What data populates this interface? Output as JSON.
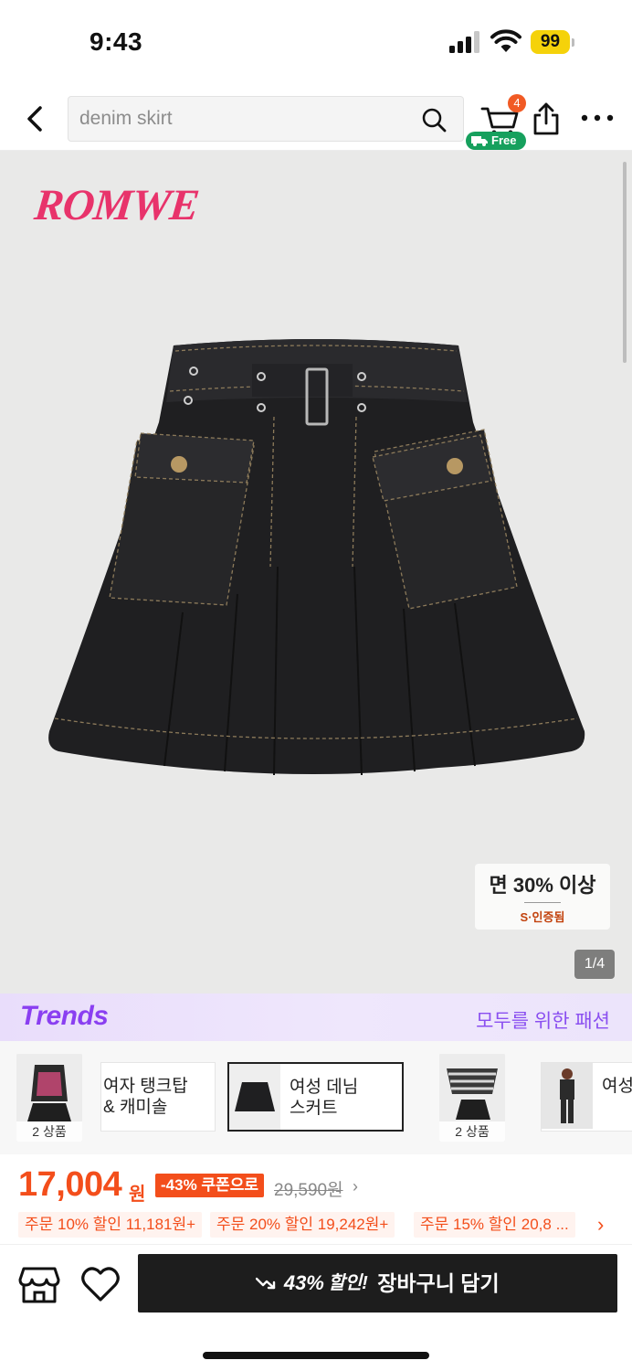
{
  "status_bar": {
    "time": "9:43",
    "battery": "99",
    "battery_color": "#f5d20a"
  },
  "header": {
    "search_placeholder": "denim skirt",
    "cart_count": "4",
    "free_shipping_label": "Free",
    "icons": [
      "back-arrow-icon",
      "search-icon",
      "cart-icon",
      "truck-icon",
      "share-icon",
      "more-icon"
    ]
  },
  "product_image": {
    "brand": "ROMWE",
    "brand_color": "#e8336b",
    "cert_title": "면 30% 이상",
    "cert_sub": "S·인증됨",
    "counter": "1/4"
  },
  "trends": {
    "logo": "Trends",
    "slogan": "모두를 위한 패션",
    "accent": "#8a3ff1",
    "items": [
      {
        "type": "thumb",
        "count": "2 상품"
      },
      {
        "type": "chip",
        "label": "여자 탱크탑\n& 캐미솔",
        "active": false
      },
      {
        "type": "chip",
        "label": "여성 데님\n스커트",
        "active": true
      },
      {
        "type": "thumb",
        "count": "2 상품"
      },
      {
        "type": "chip",
        "label": "여성",
        "active": false
      }
    ]
  },
  "price": {
    "current": "17,004",
    "unit": "원",
    "discount_tag": "-43% 쿠폰으로",
    "original": "29,590원",
    "accent": "#f34e1b",
    "promos": [
      "주문 10% 할인 11,181원+",
      "주문 20% 할인 19,242원+",
      "주문 15% 할인 20,8 ..."
    ]
  },
  "bottom_bar": {
    "discount": "43%",
    "discount_suffix": "할인!",
    "add_to_cart": "장바구니 담기",
    "icons": [
      "store-icon",
      "heart-icon",
      "trending-down-icon"
    ]
  }
}
